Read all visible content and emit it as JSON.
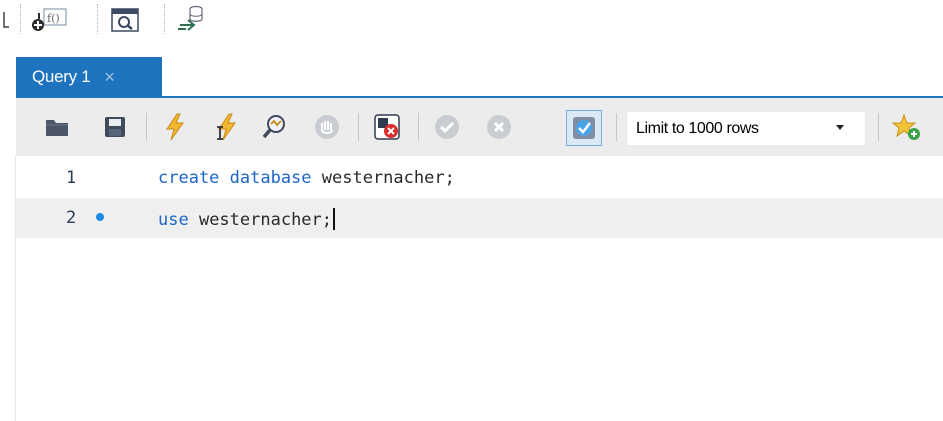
{
  "app_toolbar": {
    "icons": [
      "cut-icon",
      "function-insert-icon",
      "inspect-table-icon",
      "sync-schema-icon"
    ]
  },
  "tabs": [
    {
      "label": "Query 1",
      "close": "×",
      "active": true
    }
  ],
  "editor_toolbar": {
    "icons": [
      "open-file-icon",
      "save-icon",
      "execute-icon",
      "execute-current-icon",
      "explain-icon",
      "stop-icon",
      "toggle-stop-on-error-icon",
      "commit-icon",
      "rollback-icon",
      "autocommit-icon",
      "add-snippet-icon"
    ],
    "limit_select": {
      "value": "Limit to 1000 rows"
    }
  },
  "editor": {
    "lines": [
      {
        "number": "1",
        "keywords": "create database",
        "rest": " westernacher;",
        "current": false,
        "marker": false
      },
      {
        "number": "2",
        "keywords": "use",
        "rest": " westernacher;",
        "current": true,
        "marker": true
      }
    ]
  },
  "colors": {
    "accent": "#1e73be",
    "keyword": "#1b66c9",
    "marker": "#1e88e5",
    "toolbar_bg": "#ececec",
    "current_line": "#efefef"
  }
}
